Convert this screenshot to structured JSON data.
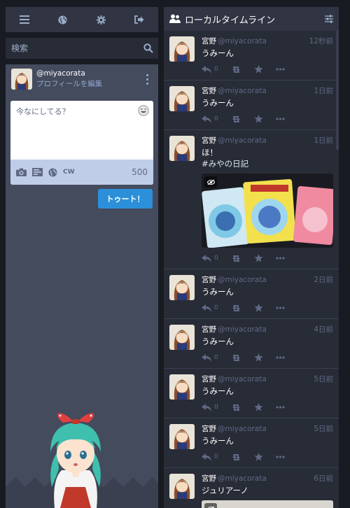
{
  "nav": {
    "icons": [
      "menu-icon",
      "globe-icon",
      "gear-icon",
      "logout-icon"
    ]
  },
  "search": {
    "placeholder": "検索"
  },
  "account": {
    "handle": "@miyacorata",
    "edit_profile": "プロフィールを編集"
  },
  "compose": {
    "placeholder": "今なにしてる？",
    "cw_label": "CW",
    "char_count": "500",
    "toot_label": "トゥート！"
  },
  "column": {
    "title": "ローカルタイムライン"
  },
  "statuses": [
    {
      "name": "宮野",
      "acct": "@miyacorata",
      "time": "12秒前",
      "content": "うみーん",
      "replies": "0"
    },
    {
      "name": "宮野",
      "acct": "@miyacorata",
      "time": "1日前",
      "content": "うみーん",
      "replies": "0"
    },
    {
      "name": "宮野",
      "acct": "@miyacorata",
      "time": "1日前",
      "content_line1": "ほ！",
      "content_line2": "#みやの日記",
      "replies": "0"
    },
    {
      "name": "宮野",
      "acct": "@miyacorata",
      "time": "2日前",
      "content": "うみーん",
      "replies": "0"
    },
    {
      "name": "宮野",
      "acct": "@miyacorata",
      "time": "4日前",
      "content": "うみーん",
      "replies": "0"
    },
    {
      "name": "宮野",
      "acct": "@miyacorata",
      "time": "5日前",
      "content": "うみーん",
      "replies": "0"
    },
    {
      "name": "宮野",
      "acct": "@miyacorata",
      "time": "5日前",
      "content": "うみーん",
      "replies": "0"
    },
    {
      "name": "宮野",
      "acct": "@miyacorata",
      "time": "6日前",
      "content": "ジュリアーノ"
    }
  ],
  "colors": {
    "background": "#191b22",
    "panel": "#444b5d",
    "column": "#282c37",
    "accent": "#2b90d9",
    "muted": "#606984"
  }
}
